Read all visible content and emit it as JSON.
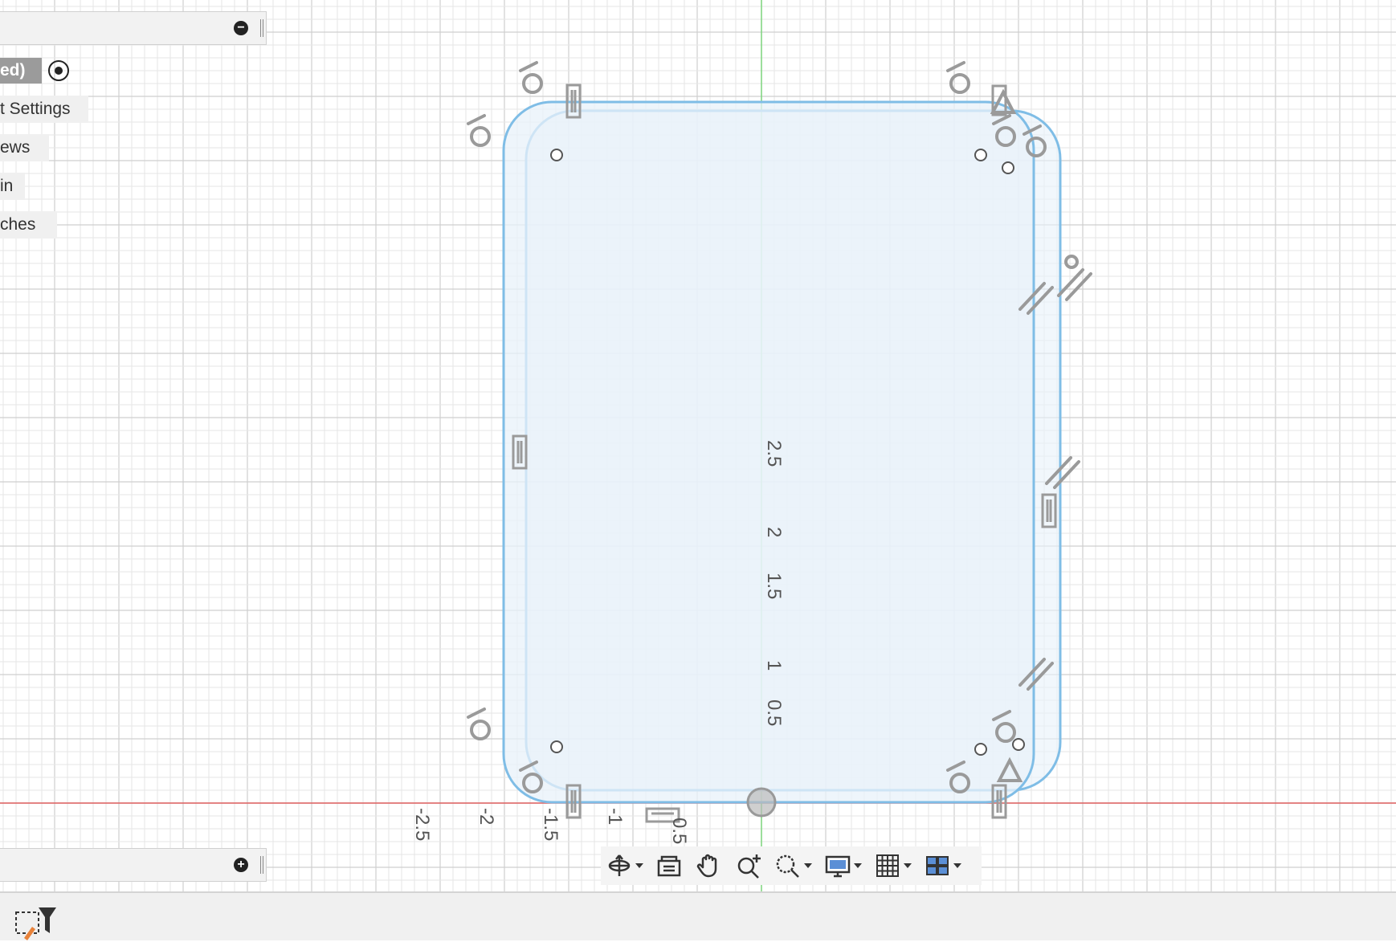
{
  "browser": {
    "items": [
      {
        "label": "ed)",
        "selected": true
      },
      {
        "label": "t Settings"
      },
      {
        "label": "ews"
      },
      {
        "label": "in"
      },
      {
        "label": "ches"
      }
    ]
  },
  "axis_labels": {
    "y": [
      "2.5",
      "2",
      "1.5",
      "1",
      "0.5"
    ],
    "x": [
      "-2.5",
      "-2",
      "-1.5",
      "-1",
      "0.5"
    ]
  },
  "colors": {
    "profile_fill": "#e8f2fa",
    "profile_stroke": "#7fbde6",
    "x_axis": "#e06060",
    "y_axis": "#7ed67e",
    "grid_minor": "#e6e6e6",
    "grid_major": "#cfcfcf"
  },
  "icons": {
    "browser_collapse": "minus-circle-icon",
    "comments_expand": "plus-circle-icon",
    "nav": [
      "orbit-icon",
      "look-at-icon",
      "pan-hand-icon",
      "zoom-icon",
      "zoom-window-icon",
      "display-settings-icon",
      "grid-settings-icon",
      "viewports-icon"
    ],
    "sketch_tool": "sketch-rectangle-icon"
  }
}
